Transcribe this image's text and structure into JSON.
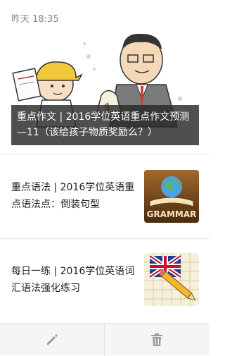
{
  "card": {
    "timestamp": "昨天 18:35",
    "cover": {
      "caption": "重点作文 | 2016学位英语重点作文预测—11（该给孩子物质奖励么？）",
      "image_icon": "cartoon-teacher-and-child-illustration"
    },
    "articles": [
      {
        "title": "重点语法 | 2016学位英语重点语法点：倒装句型",
        "thumb_icon": "grammar-book-icon",
        "thumb_text": "GRAMMAR"
      },
      {
        "title": "每日一练 | 2016学位英语词汇语法强化练习",
        "thumb_icon": "crossword-flag-pencil-icon"
      }
    ]
  },
  "toolbar": {
    "edit_icon": "pencil-icon",
    "delete_icon": "trash-icon"
  }
}
